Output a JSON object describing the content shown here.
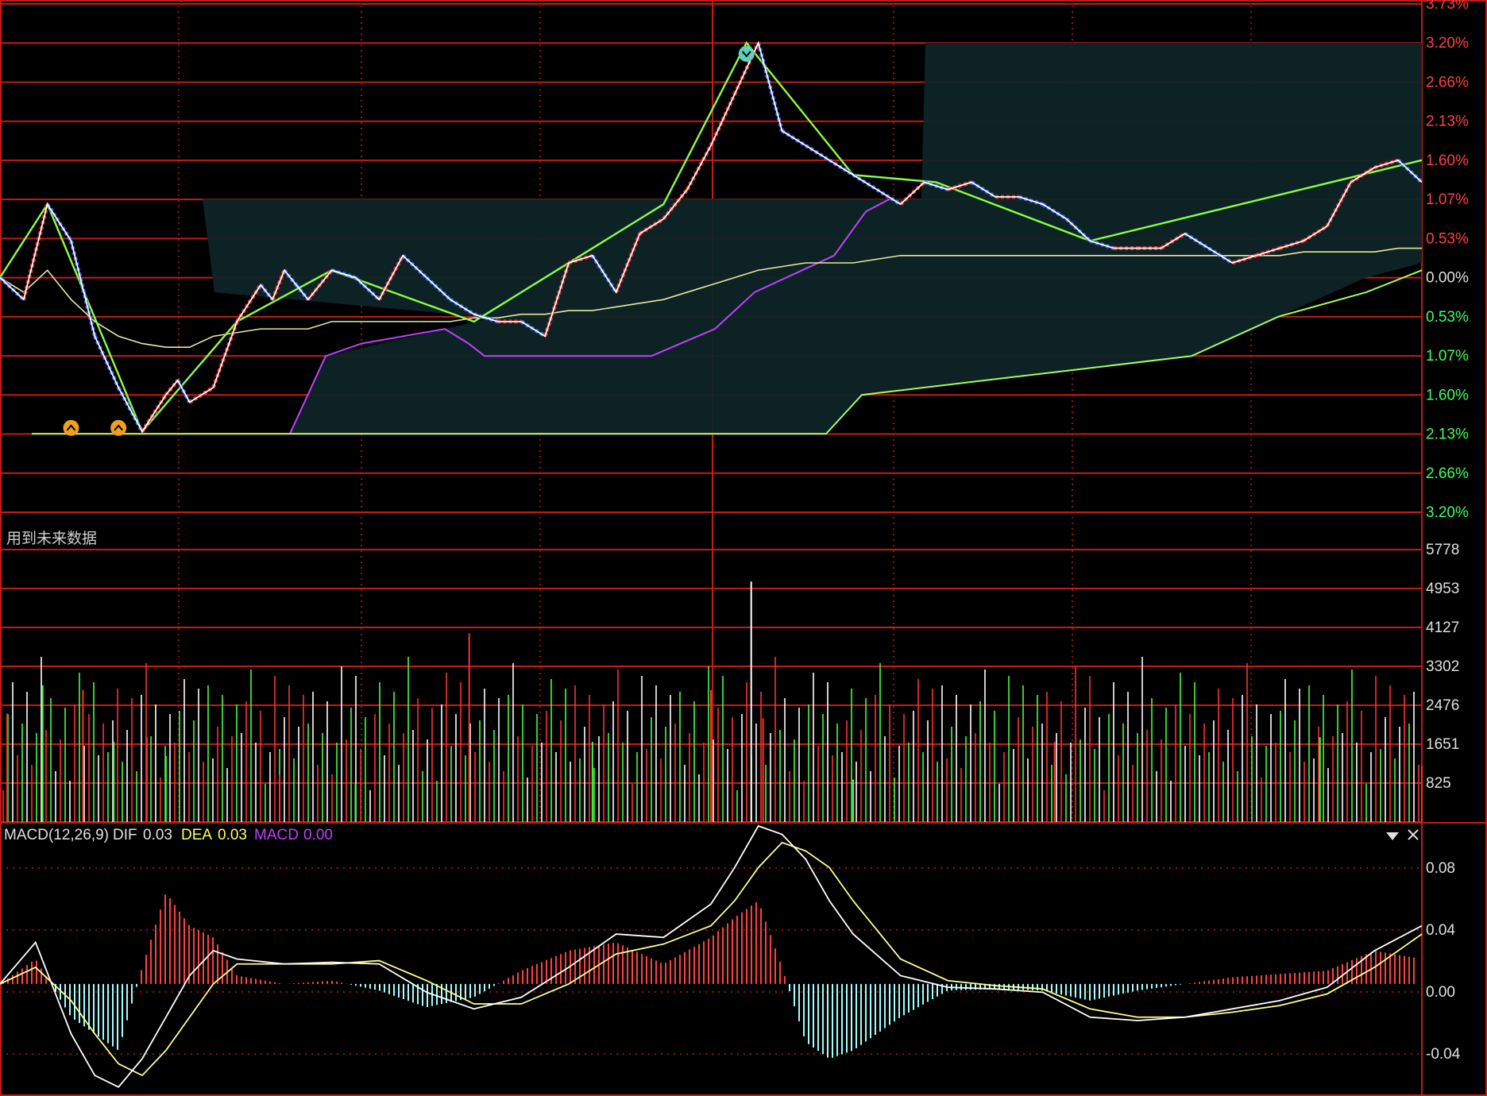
{
  "note": "用到未来数据",
  "colors": {
    "grid": "#c41a1a",
    "price": "#ffffff",
    "avg": "#e8e8a0",
    "up": "#ff2a2a",
    "down": "#3b6cff",
    "swing": "#8cff40",
    "zigzag": "#ff2a2a",
    "cloud": "#0e2426",
    "cloud_lower_edge": "#c040ff",
    "cloud_green_edge": "#a8ff50",
    "macd_pos": "#ff4040",
    "macd_neg": "#a0ffff",
    "dif": "#ffffff",
    "dea": "#ffff90",
    "dea_label": "#ffff60",
    "macd_label": "#c040ff",
    "axis_text_red": "#ff4040",
    "axis_text_white": "#e0e0e0",
    "vol_up": "#ff3030",
    "vol_down": "#40ff40",
    "vol_flat": "#ffffff"
  },
  "icons": {
    "low_marker": "chevron-up-circle-icon",
    "high_marker": "chevron-down-circle-icon",
    "dropdown": "chevron-down-icon",
    "close": "close-icon"
  },
  "chart_data": [
    {
      "type": "line",
      "panel": "intraday-price",
      "yticks": [
        "3.73%",
        "3.20%",
        "2.66%",
        "2.13%",
        "1.60%",
        "1.07%",
        "0.53%",
        "0.00%",
        "0.53%",
        "1.07%",
        "1.60%",
        "2.13%",
        "2.66%",
        "3.20%"
      ],
      "ylim": [
        -3.2,
        3.73
      ],
      "x": [
        0,
        10,
        20,
        30,
        40,
        50,
        60,
        70,
        75,
        80,
        90,
        100,
        110,
        115,
        120,
        125,
        130,
        140,
        150,
        160,
        170,
        180,
        190,
        200,
        210,
        220,
        230,
        240,
        250,
        260,
        270,
        280,
        290,
        300,
        310,
        320,
        330,
        340,
        350,
        360,
        370,
        380,
        390,
        400,
        410,
        420,
        430,
        440,
        450,
        460,
        470,
        480,
        490,
        500,
        510,
        520,
        530,
        540,
        550,
        560,
        570,
        580,
        590,
        600
      ],
      "series": [
        {
          "role": "price",
          "values": [
            0.0,
            -0.3,
            1.0,
            0.5,
            -0.8,
            -1.5,
            -2.1,
            -1.6,
            -1.4,
            -1.7,
            -1.5,
            -0.6,
            -0.1,
            -0.3,
            0.1,
            -0.1,
            -0.3,
            0.1,
            0.0,
            -0.3,
            0.3,
            0.0,
            -0.3,
            -0.5,
            -0.6,
            -0.6,
            -0.8,
            0.2,
            0.3,
            -0.2,
            0.6,
            0.8,
            1.2,
            1.8,
            2.5,
            3.2,
            2.0,
            1.8,
            1.6,
            1.4,
            1.2,
            1.0,
            1.3,
            1.2,
            1.3,
            1.1,
            1.1,
            1.0,
            0.8,
            0.5,
            0.4,
            0.4,
            0.4,
            0.6,
            0.4,
            0.2,
            0.3,
            0.4,
            0.5,
            0.7,
            1.3,
            1.5,
            1.6,
            1.3
          ]
        },
        {
          "role": "average",
          "values": [
            0.0,
            -0.2,
            0.1,
            -0.3,
            -0.6,
            -0.8,
            -0.9,
            -0.95,
            -0.95,
            -0.95,
            -0.8,
            -0.75,
            -0.7,
            -0.7,
            -0.7,
            -0.7,
            -0.7,
            -0.6,
            -0.6,
            -0.6,
            -0.6,
            -0.6,
            -0.6,
            -0.55,
            -0.55,
            -0.5,
            -0.5,
            -0.45,
            -0.45,
            -0.4,
            -0.35,
            -0.3,
            -0.2,
            -0.1,
            0.0,
            0.1,
            0.15,
            0.2,
            0.2,
            0.2,
            0.25,
            0.3,
            0.3,
            0.3,
            0.3,
            0.3,
            0.3,
            0.3,
            0.3,
            0.3,
            0.3,
            0.3,
            0.3,
            0.3,
            0.3,
            0.3,
            0.3,
            0.3,
            0.35,
            0.35,
            0.35,
            0.35,
            0.4,
            0.4
          ]
        }
      ],
      "markers": [
        {
          "type": "low",
          "x": 30,
          "value": -2.05
        },
        {
          "type": "low",
          "x": 50,
          "value": -2.05
        },
        {
          "type": "high",
          "x": 315,
          "value": 3.05
        }
      ]
    },
    {
      "type": "bar",
      "panel": "volume",
      "yticks": [
        "5778",
        "4953",
        "4127",
        "3302",
        "2476",
        "1651",
        "825"
      ],
      "ylim": [
        0,
        5778
      ],
      "x": [
        3,
        18,
        35,
        48,
        62,
        70,
        118,
        150,
        198,
        250,
        300,
        317,
        322,
        360,
        445,
        557,
        600
      ],
      "values": [
        2300,
        2900,
        2800,
        1700,
        1800,
        1400,
        1000,
        800,
        4000,
        1700,
        2800,
        5100,
        2200,
        900,
        1700,
        1800,
        1200
      ]
    },
    {
      "type": "line",
      "panel": "macd",
      "title": "MACD(12,26,9)",
      "legend": [
        {
          "name": "DIF",
          "value": "0.03"
        },
        {
          "name": "DEA",
          "value": "0.03"
        },
        {
          "name": "MACD",
          "value": "0.00"
        }
      ],
      "yticks": [
        "0.08",
        "0.04",
        "0.00",
        "-0.04"
      ],
      "ylim": [
        -0.065,
        0.095
      ],
      "x": [
        0,
        15,
        30,
        40,
        50,
        60,
        70,
        80,
        90,
        100,
        120,
        140,
        160,
        180,
        200,
        220,
        240,
        260,
        280,
        300,
        310,
        320,
        330,
        340,
        350,
        360,
        380,
        400,
        420,
        440,
        460,
        480,
        500,
        520,
        540,
        560,
        580,
        600
      ],
      "series": [
        {
          "name": "DIF",
          "values": [
            0.0,
            0.025,
            -0.03,
            -0.055,
            -0.062,
            -0.045,
            -0.02,
            0.005,
            0.02,
            0.015,
            0.012,
            0.013,
            0.012,
            -0.005,
            -0.015,
            -0.008,
            0.01,
            0.03,
            0.028,
            0.048,
            0.07,
            0.095,
            0.09,
            0.075,
            0.05,
            0.03,
            0.005,
            -0.002,
            -0.003,
            -0.005,
            -0.02,
            -0.022,
            -0.02,
            -0.015,
            -0.01,
            -0.002,
            0.02,
            0.035
          ]
        },
        {
          "name": "DEA",
          "values": [
            0.0,
            0.01,
            -0.01,
            -0.03,
            -0.048,
            -0.055,
            -0.04,
            -0.02,
            0.0,
            0.012,
            0.012,
            0.012,
            0.014,
            0.002,
            -0.012,
            -0.012,
            0.0,
            0.018,
            0.024,
            0.035,
            0.05,
            0.07,
            0.085,
            0.08,
            0.07,
            0.05,
            0.015,
            0.002,
            -0.001,
            -0.003,
            -0.015,
            -0.02,
            -0.02,
            -0.017,
            -0.013,
            -0.006,
            0.01,
            0.03
          ]
        },
        {
          "name": "MACD",
          "values": [
            0.0,
            0.015,
            -0.02,
            -0.03,
            -0.04,
            0.01,
            0.055,
            0.035,
            0.028,
            0.005,
            0.0,
            0.002,
            -0.004,
            -0.014,
            -0.008,
            0.008,
            0.02,
            0.025,
            0.012,
            0.028,
            0.04,
            0.05,
            0.01,
            -0.035,
            -0.045,
            -0.04,
            -0.02,
            -0.004,
            -0.003,
            -0.004,
            -0.01,
            -0.004,
            0.0,
            0.004,
            0.006,
            0.008,
            0.02,
            0.015
          ]
        }
      ]
    }
  ]
}
